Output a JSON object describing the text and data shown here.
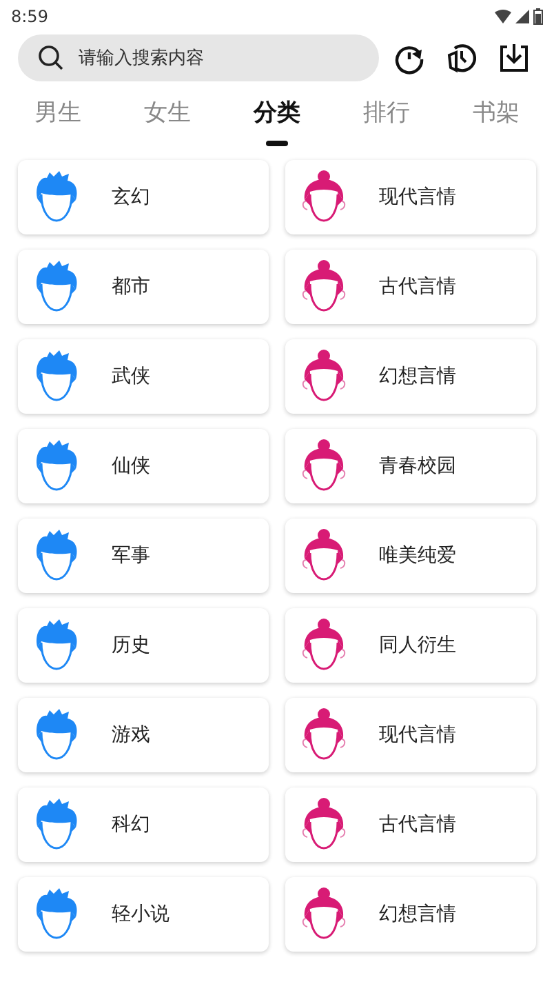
{
  "status_bar": {
    "time": "8:59"
  },
  "search": {
    "placeholder": "请输入搜索内容"
  },
  "tabs": [
    {
      "label": "男生",
      "selected": false
    },
    {
      "label": "女生",
      "selected": false
    },
    {
      "label": "分类",
      "selected": true
    },
    {
      "label": "排行",
      "selected": false
    },
    {
      "label": "书架",
      "selected": false
    }
  ],
  "categories": [
    {
      "label": "玄幻",
      "kind": "boy"
    },
    {
      "label": "现代言情",
      "kind": "girl"
    },
    {
      "label": "都市",
      "kind": "boy"
    },
    {
      "label": "古代言情",
      "kind": "girl"
    },
    {
      "label": "武侠",
      "kind": "boy"
    },
    {
      "label": "幻想言情",
      "kind": "girl"
    },
    {
      "label": "仙侠",
      "kind": "boy"
    },
    {
      "label": "青春校园",
      "kind": "girl"
    },
    {
      "label": "军事",
      "kind": "boy"
    },
    {
      "label": "唯美纯爱",
      "kind": "girl"
    },
    {
      "label": "历史",
      "kind": "boy"
    },
    {
      "label": "同人衍生",
      "kind": "girl"
    },
    {
      "label": "游戏",
      "kind": "boy"
    },
    {
      "label": "现代言情",
      "kind": "girl"
    },
    {
      "label": "科幻",
      "kind": "boy"
    },
    {
      "label": "古代言情",
      "kind": "girl"
    },
    {
      "label": "轻小说",
      "kind": "boy"
    },
    {
      "label": "幻想言情",
      "kind": "girl"
    }
  ]
}
